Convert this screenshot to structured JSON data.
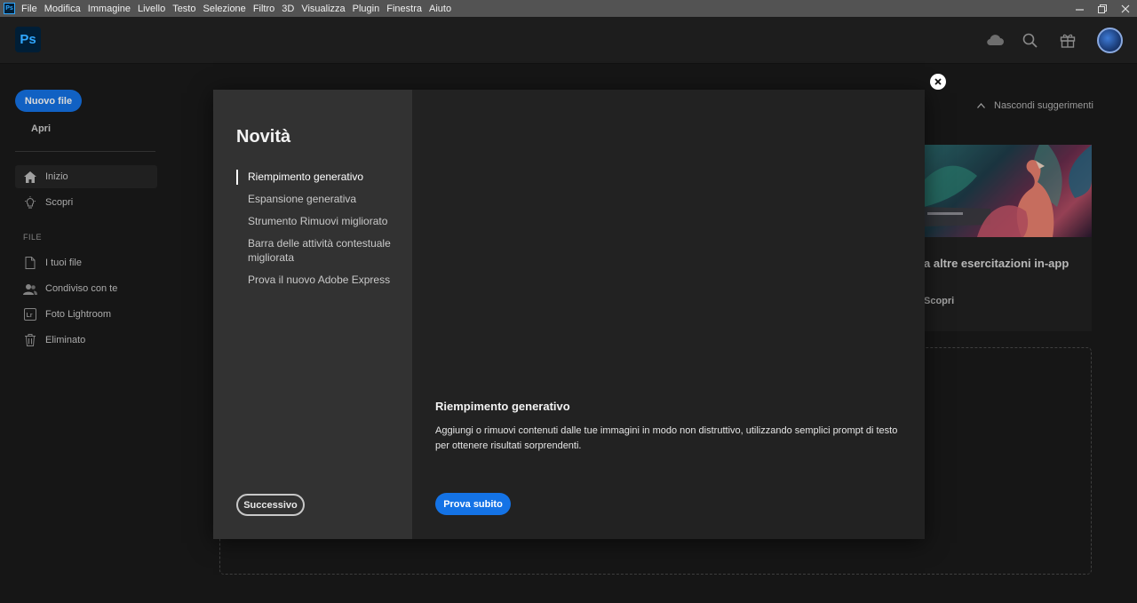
{
  "menubar": {
    "app_badge": "Ps",
    "items": [
      "File",
      "Modifica",
      "Immagine",
      "Livello",
      "Testo",
      "Selezione",
      "Filtro",
      "3D",
      "Visualizza",
      "Plugin",
      "Finestra",
      "Aiuto"
    ]
  },
  "header": {
    "logo": "Ps",
    "icons": [
      "cloud-icon",
      "search-icon",
      "gift-icon"
    ]
  },
  "sidebar": {
    "new_file": "Nuovo file",
    "open": "Apri",
    "nav": [
      {
        "label": "Inizio",
        "icon": "home-icon",
        "active": true
      },
      {
        "label": "Scopri",
        "icon": "lightbulb-icon",
        "active": false
      }
    ],
    "section_label": "FILE",
    "files": [
      {
        "label": "I tuoi file",
        "icon": "document-icon"
      },
      {
        "label": "Condiviso con te",
        "icon": "shared-users-icon"
      },
      {
        "label": "Foto Lightroom",
        "icon": "lightroom-icon"
      },
      {
        "label": "Eliminato",
        "icon": "trash-icon"
      }
    ]
  },
  "main": {
    "hide_suggestions": "Nascondi suggerimenti",
    "card": {
      "title": "a altre esercitazioni in-app",
      "link": "Scopri"
    }
  },
  "modal": {
    "title": "Novità",
    "features": [
      {
        "label": "Riempimento generativo",
        "active": true
      },
      {
        "label": "Espansione generativa",
        "active": false
      },
      {
        "label": "Strumento Rimuovi migliorato",
        "active": false
      },
      {
        "label": "Barra delle attività contestuale migliorata",
        "active": false
      },
      {
        "label": "Prova il nuovo Adobe Express",
        "active": false
      }
    ],
    "next_button": "Successivo",
    "feature_heading": "Riempimento generativo",
    "feature_description": "Aggiungi o rimuovi contenuti dalle tue immagini in modo non distruttivo, utilizzando semplici prompt di testo per ottenere risultati sorprendenti.",
    "try_button": "Prova subito"
  },
  "colors": {
    "accent": "#1473e6",
    "ps_blue": "#31a8ff",
    "menubar_bg": "#535353",
    "modal_left_bg": "#323232",
    "modal_right_bg": "#222222"
  }
}
